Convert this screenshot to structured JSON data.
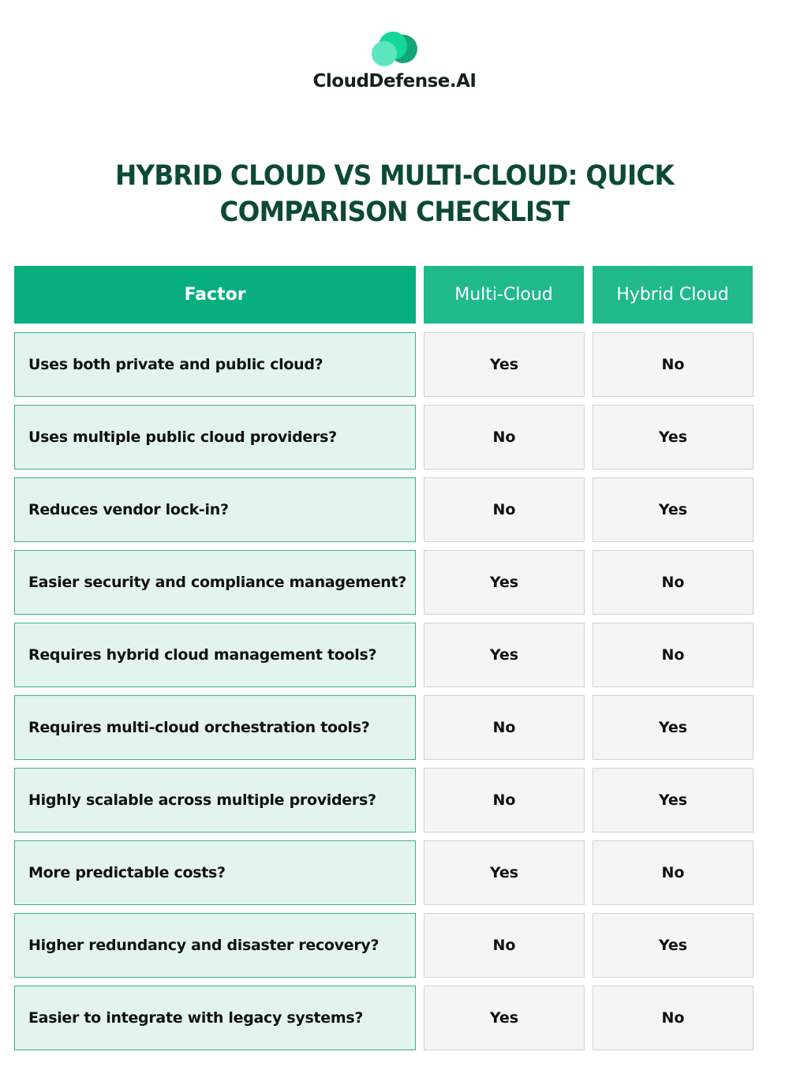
{
  "brand": {
    "logo_icon": "cloud-logo-icon",
    "name": "CloudDefense.AI",
    "colors": {
      "light": "#5ee6c0",
      "mid": "#17d69a",
      "dark": "#0fa679"
    }
  },
  "title": {
    "line1": "HYBRID CLOUD VS MULTI-CLOUD: QUICK",
    "line2": "COMPARISON CHECKLIST"
  },
  "table": {
    "headers": [
      "Factor",
      "Multi-Cloud",
      "Hybrid Cloud"
    ],
    "rows": [
      {
        "factor": "Uses both private and public cloud?",
        "multi_cloud": "Yes",
        "hybrid_cloud": "No"
      },
      {
        "factor": "Uses multiple public cloud providers?",
        "multi_cloud": "No",
        "hybrid_cloud": "Yes"
      },
      {
        "factor": "Reduces vendor lock-in?",
        "multi_cloud": "No",
        "hybrid_cloud": "Yes"
      },
      {
        "factor": "Easier security and compliance management?",
        "multi_cloud": "Yes",
        "hybrid_cloud": "No"
      },
      {
        "factor": "Requires hybrid cloud management tools?",
        "multi_cloud": "Yes",
        "hybrid_cloud": "No"
      },
      {
        "factor": "Requires multi-cloud orchestration tools?",
        "multi_cloud": "No",
        "hybrid_cloud": "Yes"
      },
      {
        "factor": "Highly scalable across multiple providers?",
        "multi_cloud": "No",
        "hybrid_cloud": "Yes"
      },
      {
        "factor": "More predictable costs?",
        "multi_cloud": "Yes",
        "hybrid_cloud": "No"
      },
      {
        "factor": "Higher redundancy and disaster recovery?",
        "multi_cloud": "No",
        "hybrid_cloud": "Yes"
      },
      {
        "factor": "Easier to integrate with legacy systems?",
        "multi_cloud": "Yes",
        "hybrid_cloud": "No"
      }
    ]
  }
}
